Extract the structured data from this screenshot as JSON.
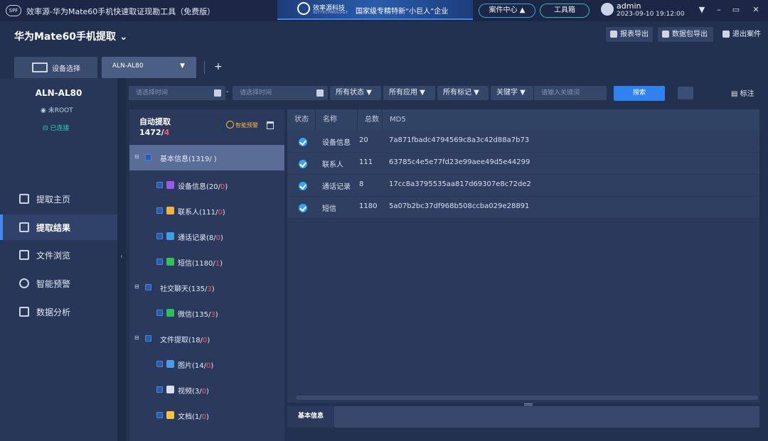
{
  "window": {
    "logo_text": "SPF",
    "title": "效率源-华为Mate60手机快速取证现勘工具（免费版）",
    "banner_brand": "效率源科技",
    "banner_brand_en": "XLYTECHNOLOGY",
    "banner_slogan": "国家级专精特新“小巨人”企业",
    "case_center": "案件中心 ▲",
    "toolbox": "工具箱",
    "user": "admin",
    "datetime": "2023-09-10 19:12:00",
    "controls": [
      "▼",
      "–",
      "▭",
      "✕"
    ]
  },
  "case": {
    "title": "华为Mate60手机提取 ⌄",
    "actions": [
      "报表导出",
      "数据包导出",
      "退出案件"
    ]
  },
  "tabs": {
    "device_select": "设备选择",
    "active_device": "ALN-AL80",
    "caret": "▼",
    "add": "+"
  },
  "device": {
    "model": "ALN-AL80",
    "root": "未ROOT",
    "connection": "已连接"
  },
  "nav": [
    {
      "label": "提取主页",
      "active": false
    },
    {
      "label": "提取结果",
      "active": true
    },
    {
      "label": "文件浏览",
      "active": false
    },
    {
      "label": "智能预警",
      "active": false
    },
    {
      "label": "数据分析",
      "active": false
    }
  ],
  "filters": {
    "start_placeholder": "请选择时间",
    "dash": "-",
    "end_placeholder": "请选择时间",
    "status": "所有状态 ▼",
    "apps": "所有应用 ▼",
    "marks": "所有标记 ▼",
    "keyword_type": "关键字 ▼",
    "keyword_placeholder": "请输入关键词",
    "search": "搜索",
    "mark": "标注"
  },
  "tree": {
    "title": "自动提取",
    "count_total": "1472/",
    "count_flag": "4",
    "smart_warning": "智能预警",
    "nodes": [
      {
        "label": "基本信息(1319/",
        "flag": "",
        "suffix": " )",
        "level": 0,
        "expanded": true,
        "selected": true
      },
      {
        "label": "设备信息(20/",
        "flag": "0",
        "suffix": ")",
        "level": 1,
        "icon": "device-info-icon",
        "color": "#9b59e8"
      },
      {
        "label": "联系人(111/",
        "flag": "0",
        "suffix": ")",
        "level": 1,
        "icon": "contacts-icon",
        "color": "#f0b43c"
      },
      {
        "label": "通话记录(8/",
        "flag": "0",
        "suffix": ")",
        "level": 1,
        "icon": "call-log-icon",
        "color": "#3aa0e8"
      },
      {
        "label": "短信(1180/",
        "flag": "1",
        "suffix": ")",
        "level": 1,
        "icon": "sms-icon",
        "color": "#33c05a"
      },
      {
        "label": "社交聊天(135/",
        "flag": "3",
        "suffix": ")",
        "level": 0,
        "expanded": true
      },
      {
        "label": "微信(135/",
        "flag": "3",
        "suffix": ")",
        "level": 1,
        "icon": "wechat-icon",
        "color": "#2cc05a"
      },
      {
        "label": "文件提取(18/",
        "flag": "0",
        "suffix": ")",
        "level": 0,
        "expanded": true
      },
      {
        "label": "图片(14/",
        "flag": "0",
        "suffix": ")",
        "level": 1,
        "icon": "image-icon",
        "color": "#4a9be8"
      },
      {
        "label": "视频(3/",
        "flag": "0",
        "suffix": ")",
        "level": 1,
        "icon": "video-icon",
        "color": "#d8e0ee"
      },
      {
        "label": "文档(1/",
        "flag": "0",
        "suffix": ")",
        "level": 1,
        "icon": "document-icon",
        "color": "#f2c53a"
      }
    ]
  },
  "table": {
    "headers": [
      "状态",
      "名称",
      "总数",
      "MD5"
    ],
    "rows": [
      {
        "name": "设备信息",
        "total": "20",
        "md5": "7a871fbadc4794569c8a3c42d88a7b73"
      },
      {
        "name": "联系人",
        "total": "111",
        "md5": "63785c4e5e77fd23e99aee49d5e44299"
      },
      {
        "name": "通话记录",
        "total": "8",
        "md5": "17cc8a3795535aa817d69307e8c72de2"
      },
      {
        "name": "短信",
        "total": "1180",
        "md5": "5a07b2bc37df968b508ccba029e28891"
      }
    ]
  },
  "detail": {
    "tab": "基本信息"
  }
}
